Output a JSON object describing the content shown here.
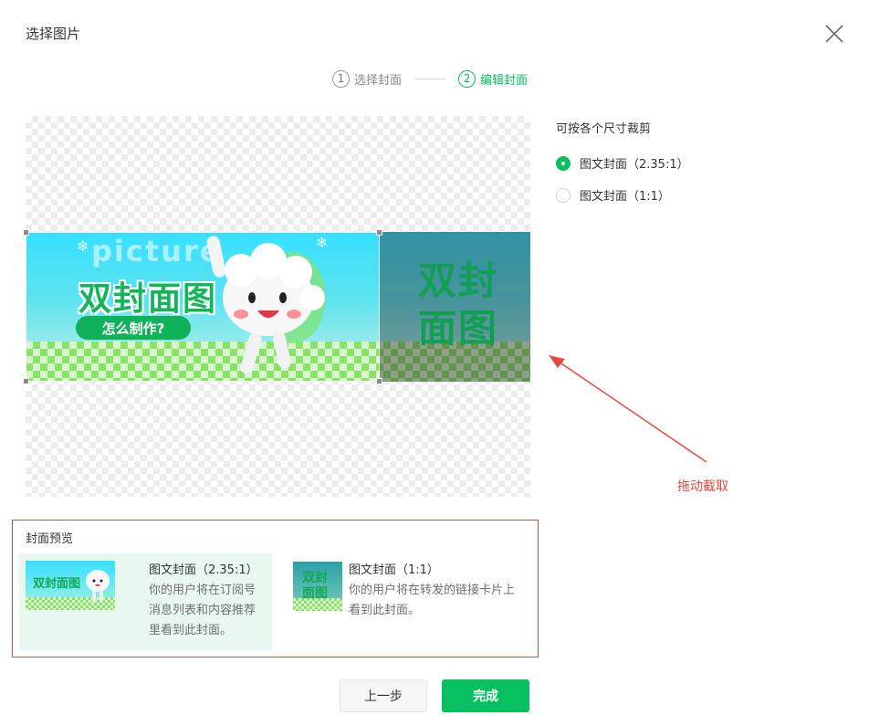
{
  "dialog": {
    "title": "选择图片",
    "close_icon": "close-icon"
  },
  "steps": [
    {
      "num": "1",
      "label": "选择封面",
      "active": false
    },
    {
      "num": "2",
      "label": "编辑封面",
      "active": true
    }
  ],
  "banner": {
    "word": "picture",
    "title": "双封面图",
    "subtitle": "怎么制作?",
    "side_title": "双封面图"
  },
  "crop_options": {
    "hint": "可按各个尺寸裁剪",
    "options": [
      {
        "label": "图文封面（2.35:1）",
        "checked": true
      },
      {
        "label": "图文封面（1:1）",
        "checked": false
      }
    ]
  },
  "annotation": {
    "label": "拖动截取",
    "color": "#e54b3d"
  },
  "preview": {
    "title": "封面预览",
    "cards": [
      {
        "name": "图文封面（2.35:1）",
        "desc": [
          "你的用户将在订阅号",
          "消息列表和内容推荐",
          "里看到此封面。"
        ]
      },
      {
        "name": "图文封面（1:1）",
        "desc": [
          "你的用户将在转发的链接卡片上",
          "看到此封面。"
        ]
      }
    ]
  },
  "footer": {
    "prev_label": "上一步",
    "done_label": "完成"
  },
  "colors": {
    "accent": "#07c160",
    "annotation": "#e54b3d"
  }
}
